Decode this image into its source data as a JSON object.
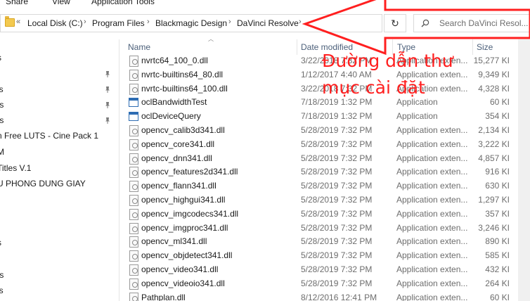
{
  "ribbon": {
    "tabs": [
      "Share",
      "View",
      "Application Tools"
    ]
  },
  "address": {
    "chevron": "«",
    "crumbs": [
      "Local Disk (C:)",
      "Program Files",
      "Blackmagic Design",
      "DaVinci Resolve"
    ],
    "separator": "›",
    "dropdown_glyph": "⌄",
    "refresh_glyph": "↻",
    "search_placeholder": "Search DaVinci Resol..."
  },
  "nav": {
    "items": [
      "s",
      "ls",
      "ts",
      "ts",
      "n Free LUTS - Cine Pack 1",
      "M",
      "Titles V.1",
      "U PHONG DUNG GIAY",
      "s",
      "ts",
      "ls"
    ],
    "pin_glyph": "📌"
  },
  "columns": {
    "name": "Name",
    "date": "Date modified",
    "type": "Type",
    "size": "Size"
  },
  "files": [
    {
      "name": "nvrtc64_100_0.dll",
      "date": "3/22/2018 7:32 PM",
      "type": "Application exten...",
      "size": "15,277 KI",
      "icon": "dll-icon"
    },
    {
      "name": "nvrtc-builtins64_80.dll",
      "date": "1/12/2017 4:40 AM",
      "type": "Application exten...",
      "size": "9,349 KI",
      "icon": "dll-icon"
    },
    {
      "name": "nvrtc-builtins64_100.dll",
      "date": "3/22/2018 7:32 PM",
      "type": "Application exten...",
      "size": "4,328 KI",
      "icon": "dll-icon"
    },
    {
      "name": "oclBandwidthTest",
      "date": "7/18/2019 1:32 PM",
      "type": "Application",
      "size": "60 KI",
      "icon": "exe-icon"
    },
    {
      "name": "oclDeviceQuery",
      "date": "7/18/2019 1:32 PM",
      "type": "Application",
      "size": "354 KI",
      "icon": "exe-icon"
    },
    {
      "name": "opencv_calib3d341.dll",
      "date": "5/28/2019 7:32 PM",
      "type": "Application exten...",
      "size": "2,134 KI",
      "icon": "dll-icon"
    },
    {
      "name": "opencv_core341.dll",
      "date": "5/28/2019 7:32 PM",
      "type": "Application exten...",
      "size": "3,222 KI",
      "icon": "dll-icon"
    },
    {
      "name": "opencv_dnn341.dll",
      "date": "5/28/2019 7:32 PM",
      "type": "Application exten...",
      "size": "4,857 KI",
      "icon": "dll-icon"
    },
    {
      "name": "opencv_features2d341.dll",
      "date": "5/28/2019 7:32 PM",
      "type": "Application exten...",
      "size": "916 KI",
      "icon": "dll-icon"
    },
    {
      "name": "opencv_flann341.dll",
      "date": "5/28/2019 7:32 PM",
      "type": "Application exten...",
      "size": "630 KI",
      "icon": "dll-icon"
    },
    {
      "name": "opencv_highgui341.dll",
      "date": "5/28/2019 7:32 PM",
      "type": "Application exten...",
      "size": "1,297 KI",
      "icon": "dll-icon"
    },
    {
      "name": "opencv_imgcodecs341.dll",
      "date": "5/28/2019 7:32 PM",
      "type": "Application exten...",
      "size": "357 KI",
      "icon": "dll-icon"
    },
    {
      "name": "opencv_imgproc341.dll",
      "date": "5/28/2019 7:32 PM",
      "type": "Application exten...",
      "size": "3,246 KI",
      "icon": "dll-icon"
    },
    {
      "name": "opencv_ml341.dll",
      "date": "5/28/2019 7:32 PM",
      "type": "Application exten...",
      "size": "890 KI",
      "icon": "dll-icon"
    },
    {
      "name": "opencv_objdetect341.dll",
      "date": "5/28/2019 7:32 PM",
      "type": "Application exten...",
      "size": "585 KI",
      "icon": "dll-icon"
    },
    {
      "name": "opencv_video341.dll",
      "date": "5/28/2019 7:32 PM",
      "type": "Application exten...",
      "size": "432 KI",
      "icon": "dll-icon"
    },
    {
      "name": "opencv_videoio341.dll",
      "date": "5/28/2019 7:32 PM",
      "type": "Application exten...",
      "size": "264 KI",
      "icon": "dll-icon"
    },
    {
      "name": "Pathplan.dll",
      "date": "8/12/2016 12:41 PM",
      "type": "Application exten...",
      "size": "60 KI",
      "icon": "dll-icon"
    }
  ],
  "annotation": {
    "line1": "Đường dẫn thư",
    "line2": "mục cài đặt",
    "color": "#ff1f1f"
  }
}
